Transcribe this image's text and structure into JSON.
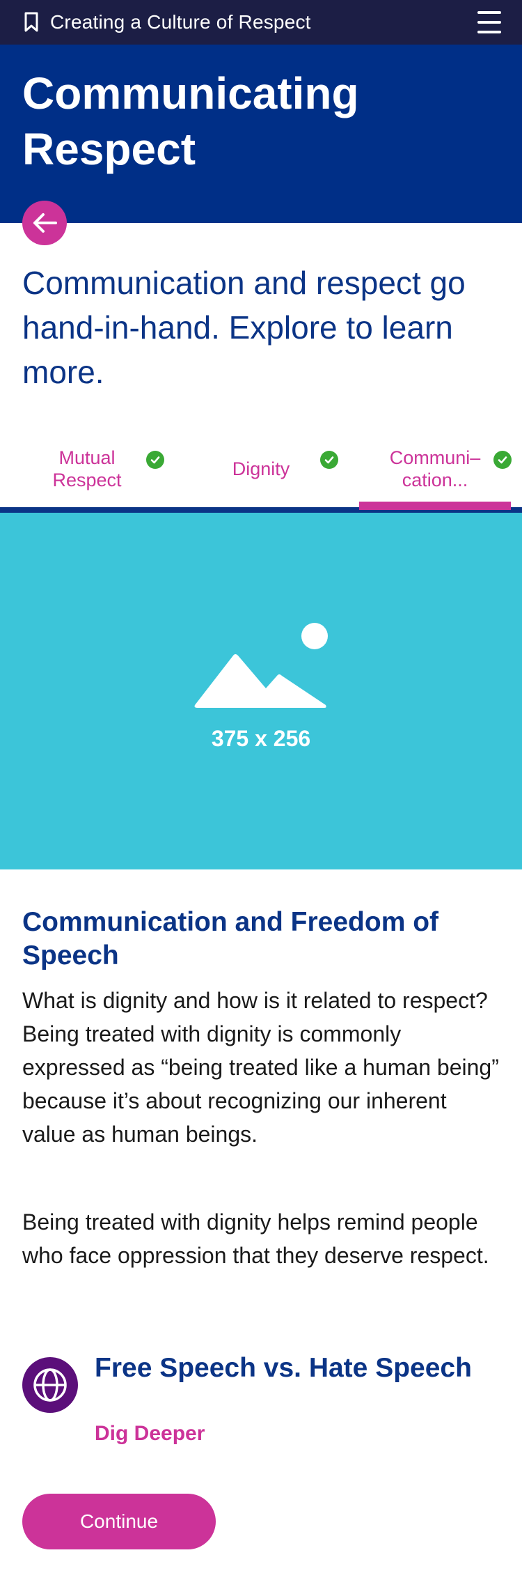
{
  "header": {
    "title": "Creating a Culture of Respect",
    "bookmark_icon": "bookmark-icon",
    "menu_icon": "menu-icon"
  },
  "hero": {
    "title": "Communicating Respect"
  },
  "intro": "Communication and respect go hand-in-hand. Explore to learn more.",
  "tabs": [
    {
      "label_line1": "Mutual",
      "label_line2": "Respect",
      "completed": true
    },
    {
      "label_line1": "Dignity",
      "label_line2": "",
      "completed": true
    },
    {
      "label_line1": "Communi–",
      "label_line2": "cation...",
      "completed": true,
      "active": true
    }
  ],
  "media": {
    "placeholder_label": "375 x 256",
    "icon": "image-placeholder-icon"
  },
  "section": {
    "title": "Communication and Freedom of Speech",
    "paragraph1": "What is dignity and how is it related to respect? Being treated with dignity is commonly expressed as “being treated like a human being” because it’s about recognizing our inherent value as human beings.",
    "paragraph2": "Being treated with dignity helps remind people who face oppression that they deserve respect."
  },
  "dig_deeper": {
    "title": "Free Speech vs. Hate Speech",
    "subtitle": "Dig Deeper",
    "icon": "globe-icon"
  },
  "continue_label": "Continue",
  "colors": {
    "topbar": "#1c1e45",
    "hero": "#002f87",
    "accent": "#cc3399",
    "navy_text": "#0b3486",
    "media_bg": "#3cc5d9",
    "check": "#3aa935",
    "icon_circle": "#5b0f7a"
  }
}
